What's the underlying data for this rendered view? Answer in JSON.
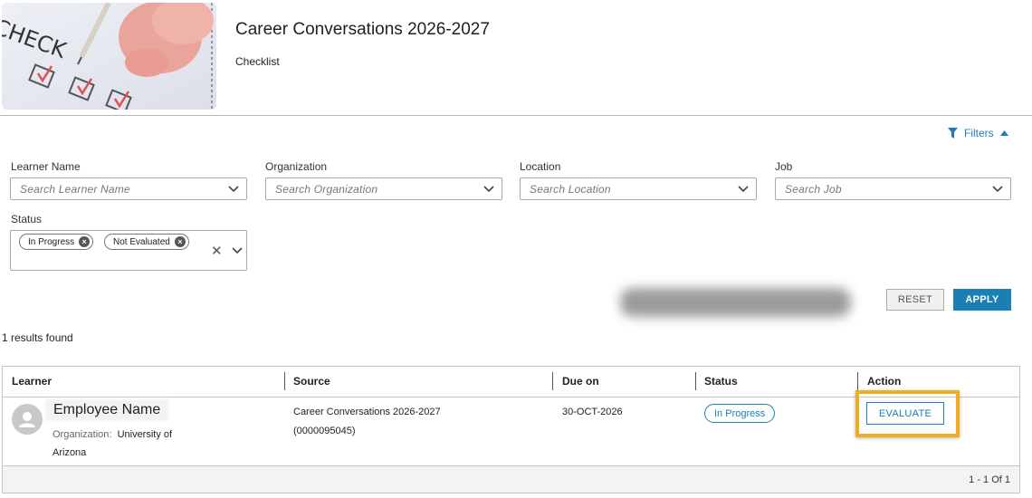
{
  "header": {
    "title": "Career Conversations 2026-2027",
    "subtitle": "Checklist",
    "image_text": "CHECK"
  },
  "filters": {
    "toggle_label": "Filters",
    "learner": {
      "label": "Learner Name",
      "placeholder": "Search Learner Name"
    },
    "organization": {
      "label": "Organization",
      "placeholder": "Search Organization"
    },
    "location": {
      "label": "Location",
      "placeholder": "Search Location"
    },
    "job": {
      "label": "Job",
      "placeholder": "Search Job"
    },
    "status": {
      "label": "Status",
      "chips": [
        "In Progress",
        "Not Evaluated"
      ]
    },
    "reset_label": "RESET",
    "apply_label": "APPLY"
  },
  "results_text": "1 results found",
  "table": {
    "columns": [
      "Learner",
      "Source",
      "Due on",
      "Status",
      "Action"
    ],
    "rows": [
      {
        "name": "Employee Name",
        "org_label": "Organization:",
        "org_value": "University of Arizona",
        "source": "Career Conversations 2026-2027",
        "source_id": "(0000095045)",
        "due": "30-OCT-2026",
        "status": "In Progress",
        "action": "EVALUATE"
      }
    ],
    "pagination": "1 - 1 Of 1"
  },
  "colors": {
    "accent": "#1a7fb5",
    "highlight": "#f0ae1f"
  }
}
